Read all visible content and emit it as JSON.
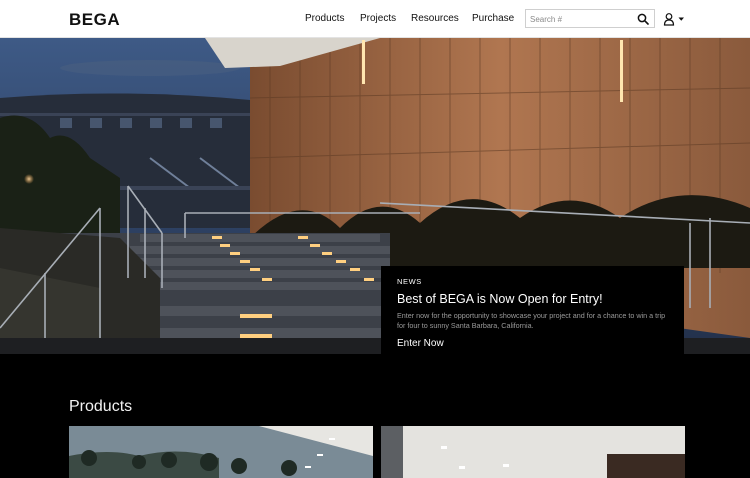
{
  "brand": {
    "logo_text": "BEGA"
  },
  "nav": {
    "items": [
      {
        "label": "Products"
      },
      {
        "label": "Projects"
      },
      {
        "label": "Resources"
      },
      {
        "label": "Purchase"
      }
    ]
  },
  "search": {
    "placeholder": "Search #",
    "value": ""
  },
  "icons": {
    "search": "search-icon",
    "user": "user-icon",
    "caret": "caret-down-icon"
  },
  "hero": {
    "news": {
      "tag": "NEWS",
      "title": "Best of BEGA is Now Open for Entry!",
      "description": "Enter now for the opportunity to showcase your project and for a chance to win a trip for four to sunny Santa Barbara, California.",
      "link": "Enter Now"
    }
  },
  "products": {
    "title": "Products"
  },
  "colors": {
    "header_bg": "#ffffff",
    "page_bg": "#000000",
    "text_light": "#ffffff",
    "muted": "#9a9a9a"
  }
}
